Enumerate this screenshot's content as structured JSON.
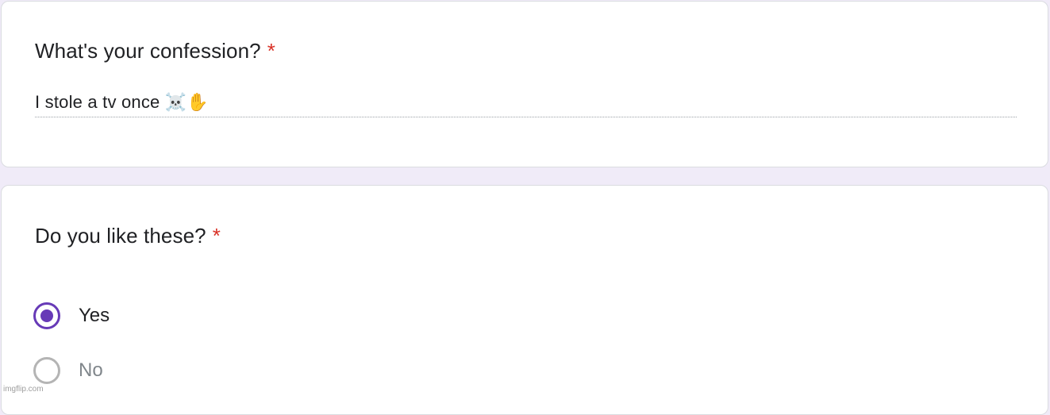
{
  "colors": {
    "background": "#f0ebf8",
    "accent": "#673ab7",
    "required": "#d93025",
    "text": "#202124"
  },
  "questions": [
    {
      "title": "What's your confession?",
      "required_mark": "*",
      "answer": "I stole a tv once ☠️✋"
    },
    {
      "title": "Do you like these?",
      "required_mark": "*",
      "options": [
        {
          "label": "Yes",
          "selected": true
        },
        {
          "label": "No",
          "selected": false
        }
      ]
    }
  ],
  "watermark": "imgflip.com"
}
